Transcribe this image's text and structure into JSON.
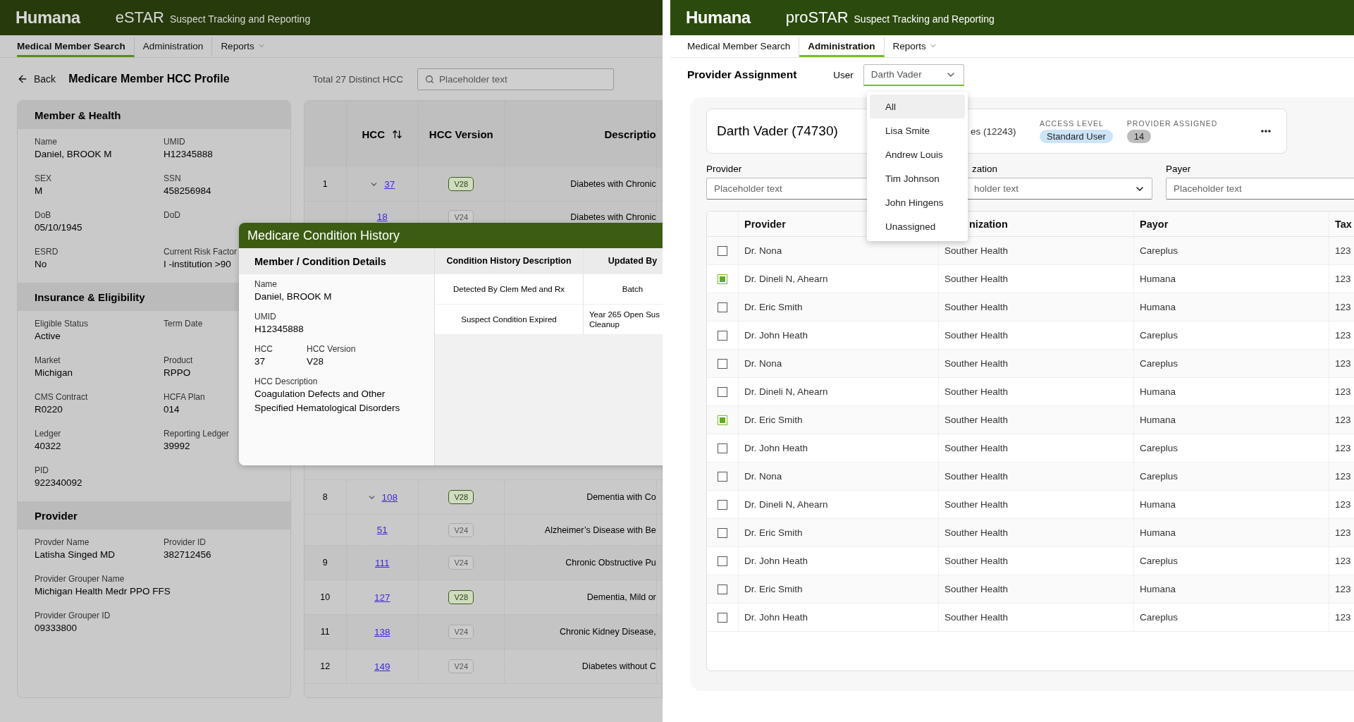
{
  "left_screen": {
    "header": {
      "logo": "Humana",
      "app_name": "eSTAR",
      "subtitle": "Suspect Tracking and Reporting"
    },
    "nav": [
      {
        "label": "Medical Member Search",
        "selected": true,
        "kind": "link"
      },
      {
        "label": "Administration",
        "selected": false,
        "kind": "link"
      },
      {
        "label": "Reports",
        "selected": false,
        "kind": "menu"
      }
    ],
    "back": "Back",
    "title": "Medicare Member HCC Profile",
    "total": "Total 27 Distinct HCC",
    "search": {
      "placeholder": "Placeholder text"
    },
    "member_sections": [
      {
        "title": "Member & Health",
        "fields": [
          {
            "label": "Name",
            "value": "Daniel, BROOK M"
          },
          {
            "label": "UMID",
            "value": "H12345888"
          },
          {
            "label": "SEX",
            "value": "M"
          },
          {
            "label": "SSN",
            "value": "458256984"
          },
          {
            "label": "DoB",
            "value": "05/10/1945"
          },
          {
            "label": "DoD"
          },
          {
            "label": "ESRD",
            "value": "No"
          },
          {
            "label": "Current Risk Factor",
            "value": "I -institution >90"
          }
        ]
      },
      {
        "title": "Insurance & Eligibility",
        "fields": [
          {
            "label": "Eligible Status",
            "value": "Active"
          },
          {
            "label": "Term Date"
          },
          {
            "label": "Market",
            "value": "Michigan"
          },
          {
            "label": "Product",
            "value": "RPPO"
          },
          {
            "label": "CMS Contract",
            "value": "R0220"
          },
          {
            "label": "HCFA Plan",
            "value": "014"
          },
          {
            "label": "Ledger",
            "value": "40322"
          },
          {
            "label": "Reporting Ledger",
            "value": "39992"
          },
          {
            "label": "PID",
            "value": "922340092"
          }
        ]
      },
      {
        "title": "Provider",
        "fields": [
          {
            "label": "Provder Name",
            "value": "Latisha Singed MD"
          },
          {
            "label": "Provider ID",
            "value": "382712456"
          },
          {
            "label": "Provider Grouper Name",
            "value": "Michigan Health Medr PPO FFS",
            "wide": true
          },
          {
            "label": "Provider Grouper ID",
            "value": "09333800",
            "wide": true
          }
        ]
      }
    ],
    "hcc_table": {
      "columns": [
        {
          "label": "HCC",
          "sortable": true
        },
        {
          "label": "HCC Version",
          "sortable": false
        },
        {
          "label": "Descriptio",
          "sortable": false
        }
      ],
      "rows": [
        {
          "index": "1",
          "hcc": "37",
          "version": "V28",
          "current": true,
          "description": "Diabetes with Chronic",
          "expanded": true,
          "children": [
            {
              "hcc": "18",
              "version": "V24",
              "current": false,
              "description": "Diabetes with Chronic"
            }
          ]
        },
        {
          "index": "8",
          "hcc": "108",
          "version": "V28",
          "current": true,
          "description": "Dementia with Co",
          "expanded": true,
          "children": [
            {
              "hcc": "51",
              "version": "V24",
              "current": false,
              "description": "Alzheimer’s Disease with Be"
            }
          ]
        },
        {
          "index": "9",
          "hcc": "111",
          "version": "V24",
          "current": false,
          "description": "Chronic Obstructive Pu"
        },
        {
          "index": "10",
          "hcc": "127",
          "version": "V28",
          "current": true,
          "description": "Dementia, Mild or"
        },
        {
          "index": "11",
          "hcc": "138",
          "version": "V24",
          "current": false,
          "description": "Chronic Kidney Disease,"
        },
        {
          "index": "12",
          "hcc": "149",
          "version": "V24",
          "current": false,
          "description": "Diabetes without C"
        }
      ]
    },
    "modal": {
      "title": "Medicare Condition History",
      "details_title": "Member / Condition Details",
      "fields": [
        {
          "label": "Name",
          "value": "Daniel, BROOK M"
        },
        {
          "label": "UMID",
          "value": "H12345888"
        },
        {
          "label": "HCC",
          "value": "37",
          "half": true
        },
        {
          "label": "HCC Version",
          "value": "V28",
          "half": true
        },
        {
          "label": "HCC Description",
          "value": "Coagulation Defects and Other Specified Hematological Disorders"
        }
      ],
      "history_columns": [
        "Condition History Description",
        "Updated By"
      ],
      "history_rows": [
        {
          "description": "Detected By Clem Med and Rx",
          "updated_by": [
            "Batch"
          ]
        },
        {
          "description": "Suspect Condition Expired",
          "updated_by": [
            "Year 265 Open Sus",
            "Cleanup"
          ]
        }
      ]
    }
  },
  "right_screen": {
    "header": {
      "logo": "Humana",
      "app_name": "proSTAR",
      "subtitle": "Suspect Tracking and Reporting"
    },
    "nav": [
      {
        "label": "Medical Member Search",
        "selected": false,
        "kind": "link"
      },
      {
        "label": "Administration",
        "selected": true,
        "kind": "link"
      },
      {
        "label": "Reports",
        "selected": false,
        "kind": "menu"
      }
    ],
    "title": "Provider Assignment",
    "user_filter": {
      "label": "User",
      "value": "Darth Vader",
      "options": [
        {
          "label": "All",
          "selected": true
        },
        {
          "label": "Lisa Smite",
          "selected": false
        },
        {
          "label": "Andrew Louis",
          "selected": false
        },
        {
          "label": "Tim Johnson",
          "selected": false
        },
        {
          "label": "John Hingens",
          "selected": false
        },
        {
          "label": "Unassigned",
          "selected": false
        }
      ]
    },
    "user_card": {
      "name": "Darth Vader (74730)",
      "organization": "es (12243)",
      "access_level": {
        "label": "ACCESS LEVEL",
        "value": "Standard User"
      },
      "providers_assigned": {
        "label": "PROVIDER ASSIGNED",
        "value": "14"
      }
    },
    "filters": [
      {
        "label": "Provider",
        "placeholder": "Placeholder text",
        "kind": "text"
      },
      {
        "label": "zation",
        "placeholder": "holder text",
        "kind": "select"
      },
      {
        "label": "Payer",
        "placeholder": "Placeholder text",
        "kind": "text"
      }
    ],
    "table": {
      "columns": [
        "Provider",
        "nization",
        "Payor",
        "Tax"
      ],
      "rows": [
        {
          "checked": false,
          "cells": [
            "Dr. Nona",
            "Souther Health",
            "Careplus",
            "123"
          ]
        },
        {
          "checked": true,
          "cells": [
            "Dr. Dineli N, Ahearn",
            "Souther Health",
            "Humana",
            "123"
          ]
        },
        {
          "checked": false,
          "cells": [
            "Dr. Eric Smith",
            "Souther Health",
            "Humana",
            "123"
          ]
        },
        {
          "checked": false,
          "cells": [
            "Dr. John Heath",
            "Souther Health",
            "Careplus",
            "123"
          ]
        },
        {
          "checked": false,
          "cells": [
            "Dr. Nona",
            "Souther Health",
            "Careplus",
            "123"
          ]
        },
        {
          "checked": false,
          "cells": [
            "Dr. Dineli N, Ahearn",
            "Souther Health",
            "Humana",
            "123"
          ]
        },
        {
          "checked": true,
          "cells": [
            "Dr. Eric Smith",
            "Souther Health",
            "Humana",
            "123"
          ]
        },
        {
          "checked": false,
          "cells": [
            "Dr. John Heath",
            "Souther Health",
            "Careplus",
            "123"
          ]
        },
        {
          "checked": false,
          "cells": [
            "Dr. Nona",
            "Souther Health",
            "Careplus",
            "123"
          ]
        },
        {
          "checked": false,
          "cells": [
            "Dr. Dineli N, Ahearn",
            "Souther Health",
            "Humana",
            "123"
          ]
        },
        {
          "checked": false,
          "cells": [
            "Dr. Eric Smith",
            "Souther Health",
            "Humana",
            "123"
          ]
        },
        {
          "checked": false,
          "cells": [
            "Dr. John Heath",
            "Souther Health",
            "Careplus",
            "123"
          ]
        },
        {
          "checked": false,
          "cells": [
            "Dr. Eric Smith",
            "Souther Health",
            "Humana",
            "123"
          ]
        },
        {
          "checked": false,
          "cells": [
            "Dr. John Heath",
            "Souther Health",
            "Careplus",
            "123"
          ]
        }
      ]
    }
  }
}
